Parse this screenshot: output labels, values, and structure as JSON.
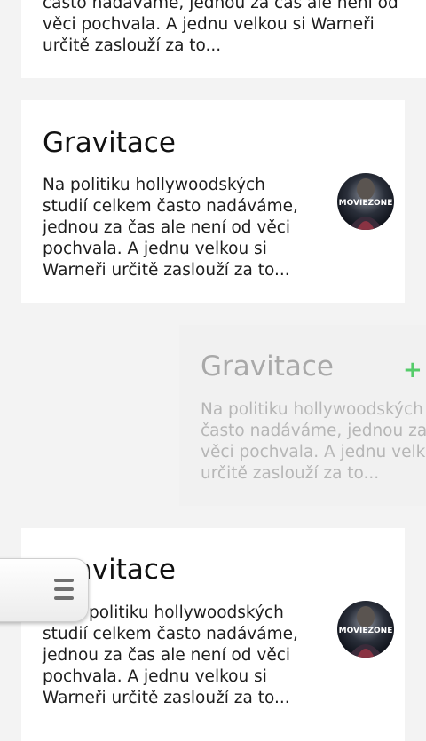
{
  "cards": [
    {
      "body": "často nadáváme, jednou za čas ale není od věci pochvala. A jednu velkou si Warneři určitě zaslouží za to..."
    },
    {
      "title": "Gravitace",
      "body": "Na politiku hollywoodských studií celkem často nadáváme, jednou za čas ale není od věci pochvala. A jednu velkou si Warneři určitě zaslouží za to...",
      "thumb_label": "MOVIEZONE"
    },
    {
      "title": "Gravitace",
      "body_lines": [
        "Na politiku hollywoodských",
        "často nadáváme, jednou za",
        "věci pochvala. A jednu velk",
        "určitě zaslouží za to..."
      ],
      "action_icon": "plus-icon",
      "action_label": "+"
    },
    {
      "title": "Gravitace",
      "body_lines": [
        "politiku hollywoodských",
        "studií celkem často nadáváme,",
        "jednou za čas ale není od věci",
        "pochvala. A jednu velkou si",
        "Warneři určitě zaslouží za to..."
      ],
      "thumb_label": "MOVIEZONE"
    }
  ],
  "drawer": {
    "icon": "menu-icon"
  },
  "colors": {
    "accent_plus": "#55cc6a",
    "background": "#f3f3f3",
    "card": "#ffffff"
  }
}
